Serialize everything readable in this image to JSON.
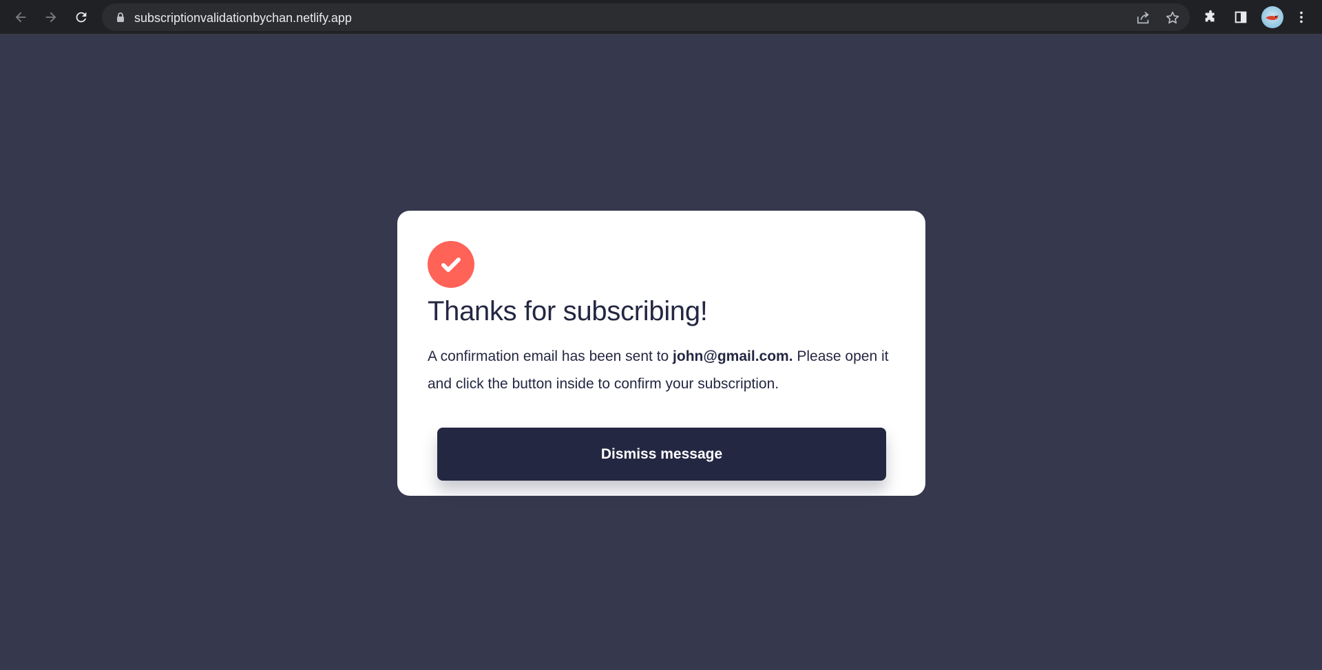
{
  "browser": {
    "url": "subscriptionvalidationbychan.netlify.app",
    "icons": [
      "back-arrow-icon",
      "forward-arrow-icon",
      "reload-icon",
      "lock-icon",
      "share-icon",
      "star-icon",
      "extensions-icon",
      "side-panel-icon",
      "profile-avatar",
      "more-menu-icon"
    ]
  },
  "card": {
    "icon": "check-circle-icon",
    "title": "Thanks for subscribing!",
    "message_before": "A confirmation email has been sent to ",
    "email": "john@gmail.com.",
    "message_after": " Please open it and click the button inside to confirm your subscription.",
    "button_label": "Dismiss message"
  },
  "colors": {
    "page_background": "#36384d",
    "card_background": "#ffffff",
    "accent": "#ff6257",
    "text_dark": "#242742",
    "button_background": "#242742"
  }
}
